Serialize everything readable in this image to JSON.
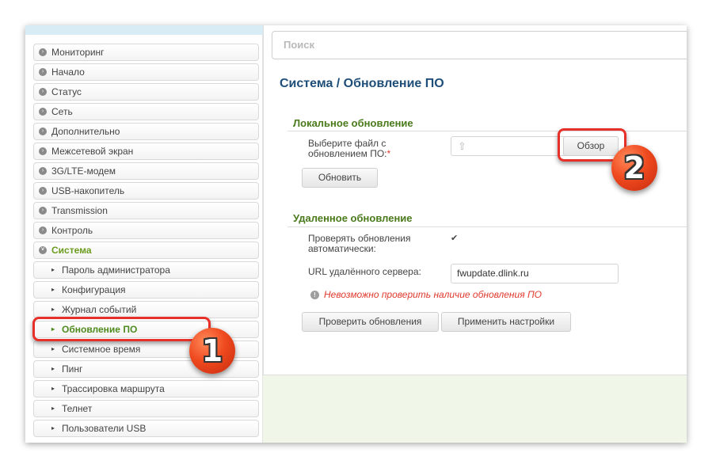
{
  "search": {
    "placeholder": "Поиск"
  },
  "page_title": "Система /  Обновление ПО",
  "sidebar": {
    "items": [
      {
        "label": "Мониторинг"
      },
      {
        "label": "Начало"
      },
      {
        "label": "Статус"
      },
      {
        "label": "Сеть"
      },
      {
        "label": "Дополнительно"
      },
      {
        "label": "Межсетевой экран"
      },
      {
        "label": "3G/LTE-модем"
      },
      {
        "label": "USB-накопитель"
      },
      {
        "label": "Transmission"
      },
      {
        "label": "Контроль"
      },
      {
        "label": "Система"
      }
    ],
    "sub_items": [
      {
        "label": "Пароль администратора"
      },
      {
        "label": "Конфигурация"
      },
      {
        "label": "Журнал событий"
      },
      {
        "label": "Обновление ПО"
      },
      {
        "label": "Системное время"
      },
      {
        "label": "Пинг"
      },
      {
        "label": "Трассировка маршрута"
      },
      {
        "label": "Телнет"
      },
      {
        "label": "Пользователи USB"
      }
    ]
  },
  "local_update": {
    "title": "Локальное обновление",
    "file_label_line1": "Выберите файл с",
    "file_label_line2": "обновлением ПО:",
    "required_mark": "*",
    "browse_button": "Обзор",
    "update_button": "Обновить"
  },
  "remote_update": {
    "title": "Удаленное обновление",
    "auto_check_line1": "Проверять обновления",
    "auto_check_line2": "автоматически:",
    "auto_check_checked": true,
    "url_label": "URL удалённого сервера:",
    "url_value": "fwupdate.dlink.ru",
    "warning": "Невозможно проверить наличие обновления ПО",
    "check_button": "Проверить обновления",
    "apply_button": "Применить настройки"
  },
  "annotations": {
    "badge1": "1",
    "badge2": "2"
  },
  "colors": {
    "accent_green": "#4f8a1d",
    "title_blue": "#1f4e79",
    "error_red": "#e03a2e",
    "highlight_red": "#e8302a"
  }
}
